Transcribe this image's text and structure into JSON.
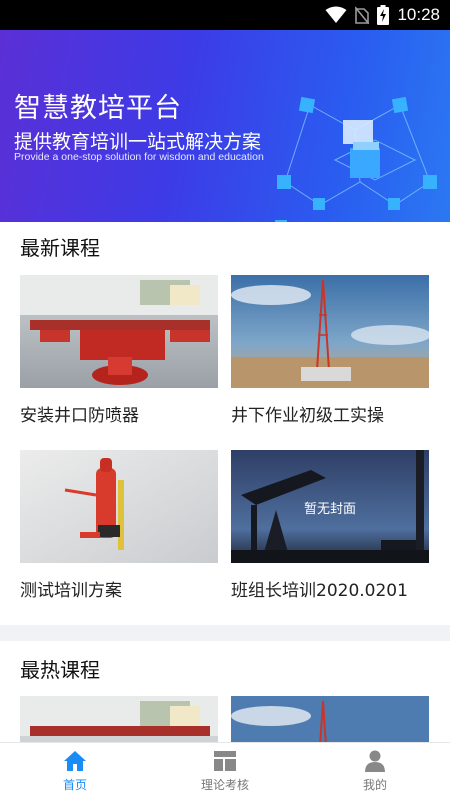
{
  "status_bar": {
    "time": "10:28",
    "icons": [
      "wifi-icon",
      "no-sim-icon",
      "battery-charging-icon"
    ]
  },
  "banner": {
    "title": "智慧教培平台",
    "subtitle": "提供教育培训一站式解决方案",
    "subtitle_en": "Provide a one-stop solution for wisdom and education"
  },
  "sections": {
    "latest": {
      "title": "最新课程",
      "courses": [
        {
          "name": "安装井口防喷器"
        },
        {
          "name": "井下作业初级工实操"
        },
        {
          "name": "测试培训方案"
        },
        {
          "name": "班组长培训2020.0201",
          "cover_text": "暂无封面"
        }
      ]
    },
    "hot": {
      "title": "最热课程"
    }
  },
  "bottom_nav": {
    "items": [
      {
        "label": "首页",
        "icon": "home-icon",
        "active": true
      },
      {
        "label": "理论考核",
        "icon": "exam-icon",
        "active": false
      },
      {
        "label": "我的",
        "icon": "user-icon",
        "active": false
      }
    ]
  },
  "colors": {
    "accent": "#1a8cf5",
    "banner_start": "#5b2fd6",
    "banner_end": "#2b78f2",
    "divider": "#f1f2f6"
  }
}
